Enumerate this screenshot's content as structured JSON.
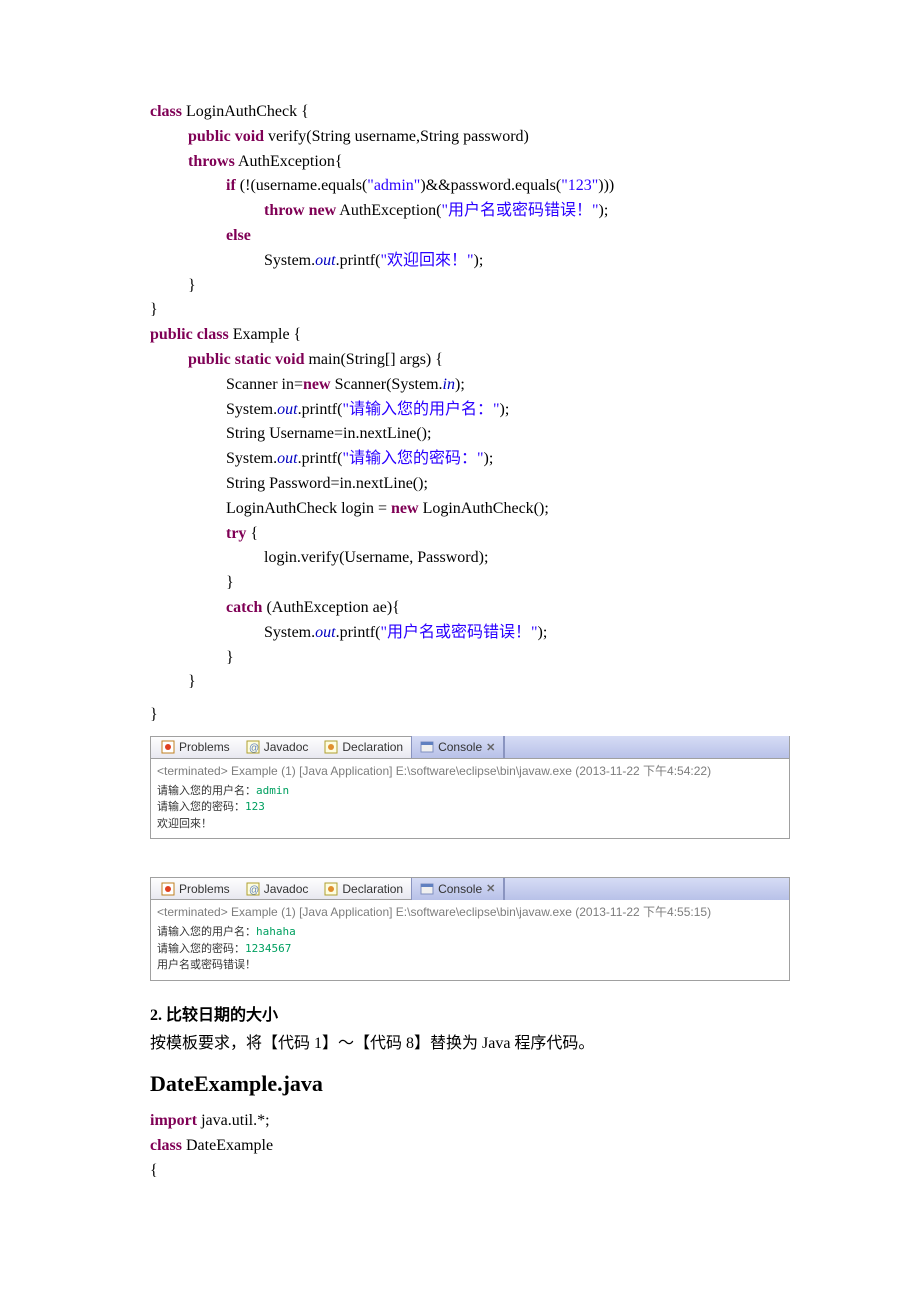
{
  "code1": {
    "l1_kw1": "class",
    "l1_txt": " LoginAuthCheck {",
    "l2_kw1": "public",
    "l2_kw2": "void",
    "l2_txt": " verify(String username,String password)",
    "l3_kw1": "throws",
    "l3_txt": " AuthException{",
    "l4_kw1": "if",
    "l4_txt1": " (!(username.equals(",
    "l4_str1": "\"admin\"",
    "l4_txt2": ")&&password.equals(",
    "l4_str2": "\"123\"",
    "l4_txt3": ")))",
    "l5_kw1": "throw",
    "l5_kw2": "new",
    "l5_txt1": " AuthException(",
    "l5_str": "\"用户名或密码错误！\"",
    "l5_txt2": ");",
    "l6_kw1": "else",
    "l7_txt1": "System.",
    "l7_fld": "out",
    "l7_txt2": ".printf(",
    "l7_str": "\"欢迎回來！\"",
    "l7_txt3": ");",
    "l8": "}",
    "l9": "}",
    "l10_kw1": "public",
    "l10_kw2": "class",
    "l10_txt": " Example {",
    "l11_kw1": "public",
    "l11_kw2": "static",
    "l11_kw3": "void",
    "l11_txt": " main(String[] args) {",
    "l12_txt1": "Scanner in=",
    "l12_kw": "new",
    "l12_txt2": " Scanner(System.",
    "l12_fld": "in",
    "l12_txt3": ");",
    "l13_txt1": "System.",
    "l13_fld": "out",
    "l13_txt2": ".printf(",
    "l13_str": "\"请输入您的用户名：\"",
    "l13_txt3": ");",
    "l14": "String Username=in.nextLine();",
    "l15_txt1": "System.",
    "l15_fld": "out",
    "l15_txt2": ".printf(",
    "l15_str": "\"请输入您的密码：\"",
    "l15_txt3": ");",
    "l16": "String Password=in.nextLine();",
    "l17_txt1": "LoginAuthCheck login = ",
    "l17_kw": "new",
    "l17_txt2": " LoginAuthCheck();",
    "l18_kw": "try",
    "l18_txt": " {",
    "l19": "login.verify(Username, Password);",
    "l20": "}",
    "l21_kw": "catch",
    "l21_txt": " (AuthException ae){",
    "l22_txt1": "System.",
    "l22_fld": "out",
    "l22_txt2": ".printf(",
    "l22_str": "\"用户名或密码错误！\"",
    "l22_txt3": ");",
    "l23": "}",
    "l24": "}",
    "l25": "}"
  },
  "tabs": {
    "problems": "Problems",
    "javadoc": "Javadoc",
    "declaration": "Declaration",
    "console": "Console",
    "close": "✕"
  },
  "console1": {
    "terminated": "<terminated> Example (1) [Java Application] E:\\software\\eclipse\\bin\\javaw.exe (2013-11-22 下午4:54:22)",
    "l1_prompt": "请输入您的用户名：",
    "l1_input": "admin",
    "l2_prompt": "请输入您的密码：",
    "l2_input": "123",
    "l3": "欢迎回來！"
  },
  "console2": {
    "terminated": "<terminated> Example (1) [Java Application] E:\\software\\eclipse\\bin\\javaw.exe (2013-11-22 下午4:55:15)",
    "l1_prompt": "请输入您的用户名：",
    "l1_input": "hahaha",
    "l2_prompt": "请输入您的密码：",
    "l2_input": "1234567",
    "l3": "用户名或密码错误！"
  },
  "section2": {
    "heading": "2.  比较日期的大小",
    "text": "按模板要求，将【代码 1】～【代码 8】替换为 Java 程序代码。",
    "filename": "DateExample.java"
  },
  "code2": {
    "l1_kw": "import",
    "l1_txt": " java.util.*;",
    "l2_kw": "class",
    "l2_txt": " DateExample",
    "l3": "{"
  },
  "icons": {
    "problems": "problems-icon",
    "javadoc": "javadoc-icon",
    "declaration": "declaration-icon",
    "console": "console-icon"
  }
}
